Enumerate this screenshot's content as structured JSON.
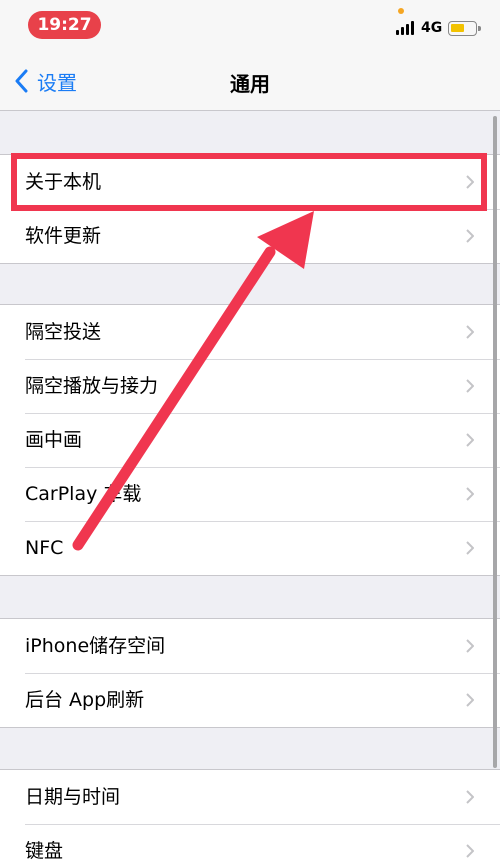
{
  "status_bar": {
    "time": "19:27",
    "network": "4G",
    "time_pill_color": "#e8414a",
    "battery_color": "#f2c200",
    "battery_level": 0.55
  },
  "nav": {
    "back_label": "设置",
    "title": "通用",
    "accent_color": "#1a7cf5"
  },
  "groups": [
    {
      "items": [
        "关于本机",
        "软件更新"
      ]
    },
    {
      "items": [
        "隔空投送",
        "隔空播放与接力",
        "画中画",
        "CarPlay 车载",
        "NFC"
      ]
    },
    {
      "items": [
        "iPhone储存空间",
        "后台 App刷新"
      ]
    },
    {
      "items": [
        "日期与时间",
        "键盘"
      ]
    }
  ],
  "annotation": {
    "highlighted_item": "关于本机",
    "color": "#f0364f"
  }
}
